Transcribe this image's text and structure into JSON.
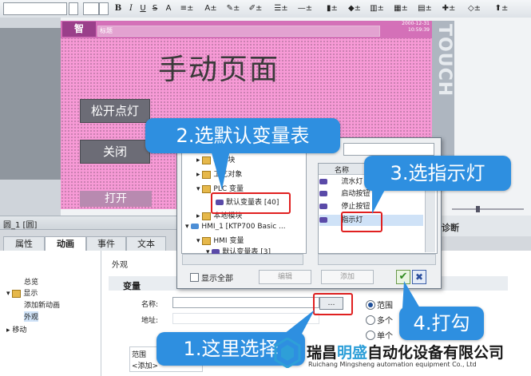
{
  "toolbar": {
    "bold": "B",
    "italic": "I",
    "underline": "U",
    "strike": "S",
    "font_size_up": "A",
    "items": [
      "≡±",
      "A±",
      "✎±",
      "✐±",
      "☰±",
      "—±",
      "▮±",
      "◆±",
      "▥±",
      "▦±",
      "▤±",
      "✚±",
      "◇±",
      "⬆±"
    ]
  },
  "hmi_screen": {
    "logo": "智",
    "header_text": "标题",
    "clock_lines": [
      "2000-12-31",
      "10:59:39"
    ],
    "brand_vertical": "TOUCH",
    "title": "手动页面",
    "buttons": [
      "松开点灯",
      "关闭",
      "打开"
    ]
  },
  "properties": {
    "header": "圆_1 [圆]",
    "tabs": [
      "属性",
      "动画",
      "事件",
      "文本"
    ],
    "active_tab": "动画",
    "right_tab": "诊断",
    "tree": [
      "总览",
      "显示",
      "添加新动画",
      "外观",
      "移动"
    ],
    "section": "外观",
    "variable_group": "变量",
    "name_label": "名称:",
    "address_label": "地址:",
    "picker_label": "…",
    "range_table": [
      "范围",
      "<添加>"
    ],
    "radio_options": [
      "范围",
      "多个",
      "单个"
    ]
  },
  "dialog": {
    "tree": [
      "程序块",
      "工艺对象",
      "PLC 变量",
      "默认变量表 [40]",
      "本地模块",
      "HMI_1 [KTP700 Basic ...",
      "HMI 变量",
      "默认变量表 [3]"
    ],
    "column_name": "名称",
    "rows": [
      "流水灯",
      "启动按钮",
      "停止按钮",
      "指示灯"
    ],
    "show_all": "显示全部",
    "edit_button": "编辑",
    "add_button": "添加",
    "ok_symbol": "✔",
    "cancel_symbol": "✖"
  },
  "callouts": {
    "step1": "1.这里选择",
    "step2": "2.选默认变量表",
    "step3": "3.选指示灯",
    "step4": "4.打勾"
  },
  "watermark": {
    "cn_before": "瑞昌",
    "cn_accent": "明盛",
    "cn_after": "自动化设备有限公司",
    "en": "Ruichang Mingsheng automation equipment Co., Ltd"
  },
  "colors": {
    "screen_bg": "#f79ad6",
    "callout": "#2e8fe0",
    "highlight": "#e02020",
    "accent": "#2e9fd8"
  }
}
